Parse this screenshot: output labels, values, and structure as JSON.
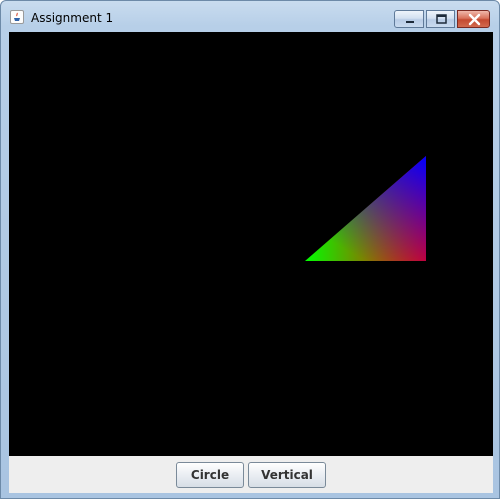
{
  "window": {
    "title": "Assignment 1",
    "icon": "java-app-icon",
    "controls": [
      "minimize-icon",
      "maximize-icon",
      "close-icon"
    ]
  },
  "canvas": {
    "background": "#000000",
    "shape": {
      "type": "triangle",
      "vertex_colors": [
        "#00ff00",
        "#ff0000",
        "#0000ff"
      ]
    }
  },
  "buttons": {
    "circle_label": "Circle",
    "vertical_label": "Vertical"
  }
}
